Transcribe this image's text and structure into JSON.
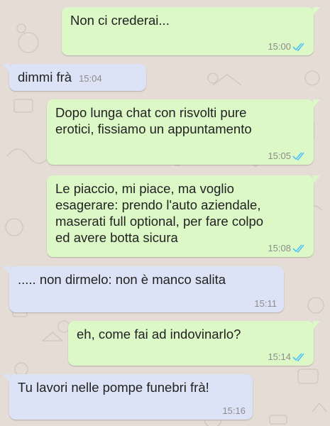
{
  "messages": [
    {
      "direction": "out",
      "text": "Non ci crederai...",
      "time": "15:00",
      "read": true
    },
    {
      "direction": "in",
      "text": "dimmi frà",
      "time": "15:04"
    },
    {
      "direction": "out",
      "text": "Dopo lunga chat con risvolti pure\nerotici, fissiamo un appuntamento",
      "time": "15:05",
      "read": true
    },
    {
      "direction": "out",
      "text": "Le piaccio, mi piace, ma voglio\nesagerare: prendo l'auto aziendale,\nmaserati full optional, per fare colpo\ned avere botta sicura",
      "time": "15:08",
      "read": true
    },
    {
      "direction": "in",
      "text": "..... non dirmelo: non è manco salita",
      "time": "15:11"
    },
    {
      "direction": "out",
      "text": "eh, come fai ad indovinarlo?",
      "time": "15:14",
      "read": true
    },
    {
      "direction": "in",
      "text": "Tu lavori nelle pompe funebri frà!",
      "time": "15:16"
    }
  ],
  "colors": {
    "outgoing_bubble": "#dcf8c6",
    "incoming_bubble": "#dde3f6",
    "read_ticks": "#4fc3f7",
    "wallpaper": "#e5ddd5"
  },
  "icons": {
    "read_receipt": "double-check-icon"
  }
}
